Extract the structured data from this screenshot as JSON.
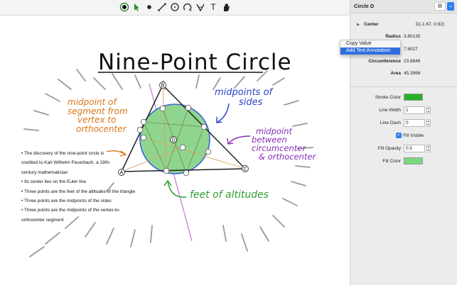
{
  "toolbar": {
    "tools": [
      {
        "name": "point-tool-icon",
        "active": true
      },
      {
        "name": "select-arrow-icon"
      },
      {
        "name": "dot-icon"
      },
      {
        "name": "line-tool-icon"
      },
      {
        "name": "circle-tool-icon"
      },
      {
        "name": "arc-tool-icon"
      },
      {
        "name": "angle-tool-icon"
      },
      {
        "name": "text-tool-icon",
        "glyph": "T"
      },
      {
        "name": "hand-tool-icon"
      }
    ]
  },
  "canvas": {
    "title": "Nine-Point Circle",
    "annotations": {
      "orange": [
        "midpoint of",
        "segment from",
        "vertex to",
        "orthocenter"
      ],
      "blue": [
        "midpoints of",
        "sides"
      ],
      "purple": [
        "midpoint",
        "between",
        "circumcenter",
        "& orthocenter"
      ],
      "green": "feet of altitudes"
    },
    "vertex_labels": {
      "a": "A",
      "b": "B",
      "c": "C",
      "d": "D"
    },
    "bullets": [
      "• The discovery of the nine-point circle is",
      "credited to Karl Wilhelm Feuerbach, a 19th-",
      "century mathematician",
      "• Its center lies on the Euler line",
      "• Three points are the feet of the altitudes of the triangle",
      "• Three points are the midpoints of the sides",
      "• Three points are the midpoints of the vertex-to-",
      "orthocenter segment"
    ],
    "colors": {
      "orange": "#d9761a",
      "blue": "#2a3fc4",
      "purple": "#8a2ab8",
      "green": "#2f9b2f",
      "fill": "#8fd58f",
      "circle_stroke": "#3a62d8"
    }
  },
  "inspector": {
    "title": "Circle D",
    "gear": "⚙",
    "menu": "⌄",
    "center": {
      "label": "Center",
      "value": "D(-1.67, 0.92)"
    },
    "radius": {
      "label": "Radius",
      "value": "3.80135"
    },
    "area_partial": {
      "value": "7.6027"
    },
    "circumference": {
      "label": "Circumference",
      "value": "23.8846"
    },
    "area": {
      "label": "Area",
      "value": "45.3968"
    },
    "context_menu": [
      "Copy Value",
      "Add Text Annotation"
    ],
    "stroke_color": {
      "label": "Stroke Color",
      "color": "#27b027"
    },
    "line_width": {
      "label": "Line Width",
      "value": "1"
    },
    "line_dash": {
      "label": "Line Dash",
      "value": "0"
    },
    "fill_visible": {
      "label": "Fill Visible",
      "checked": true
    },
    "fill_opacity": {
      "label": "Fill Opacity",
      "value": "0.5"
    },
    "fill_color": {
      "label": "Fill Color",
      "color": "#7bd87b"
    }
  }
}
